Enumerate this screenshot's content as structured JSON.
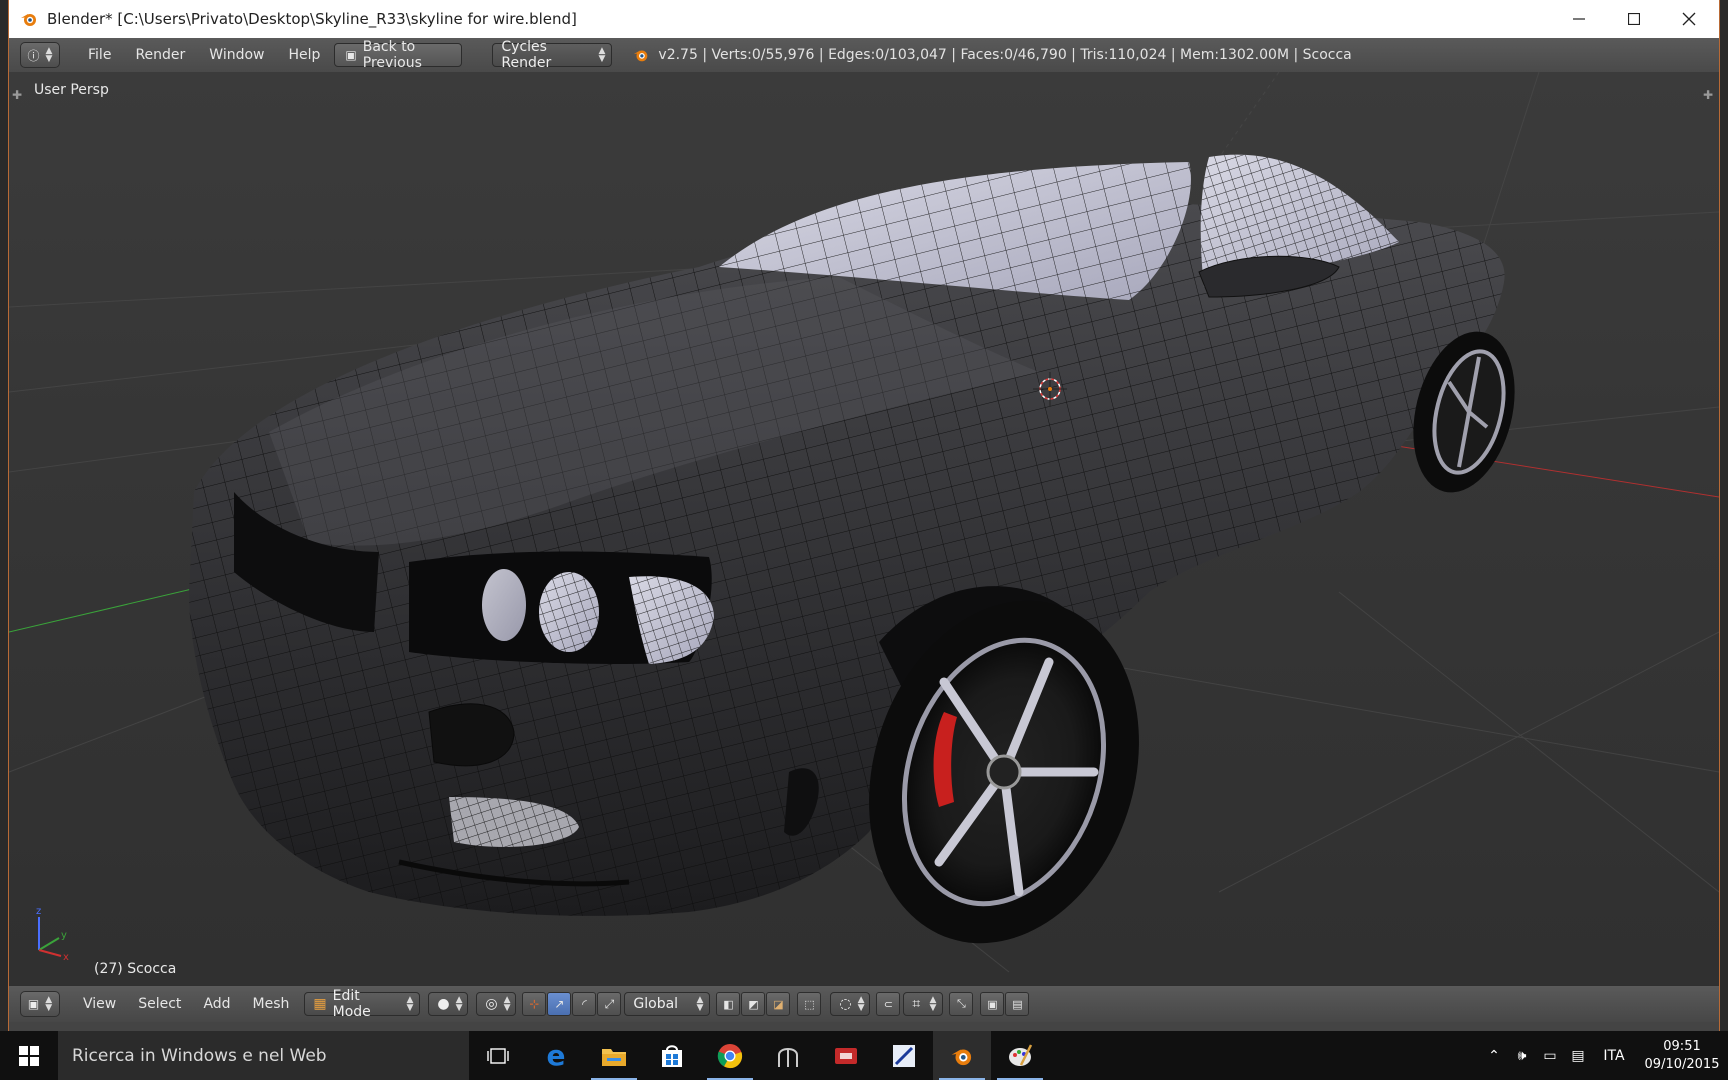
{
  "window": {
    "title": "Blender* [C:\\Users\\Privato\\Desktop\\Skyline_R33\\skyline for wire.blend]",
    "controls": [
      "minimize",
      "maximize",
      "close"
    ]
  },
  "topbar": {
    "menus": [
      "File",
      "Render",
      "Window",
      "Help"
    ],
    "back_button": "Back to Previous",
    "render_engine": "Cycles Render",
    "stats": "v2.75 | Verts:0/55,976 | Edges:0/103,047 | Faces:0/46,790 | Tris:110,024 | Mem:1302.00M | Scocca"
  },
  "viewport": {
    "view_label": "User Persp",
    "object_label": "(27) Scocca",
    "axes": [
      "z",
      "y",
      "x"
    ]
  },
  "bottombar": {
    "menus": [
      "View",
      "Select",
      "Add",
      "Mesh"
    ],
    "mode": "Edit Mode",
    "orientation": "Global"
  },
  "taskbar": {
    "search_placeholder": "Ricerca in Windows e nel Web",
    "apps": [
      "task-view",
      "edge",
      "file-explorer",
      "store",
      "chrome",
      "app-helmet",
      "app-red",
      "app-blue",
      "blender",
      "paint"
    ],
    "language": "ITA",
    "time": "09:51",
    "date": "09/10/2015"
  },
  "colors": {
    "accent_blender": "#e87d0d",
    "window_border": "#b86a36",
    "taskbar": "#101010"
  }
}
